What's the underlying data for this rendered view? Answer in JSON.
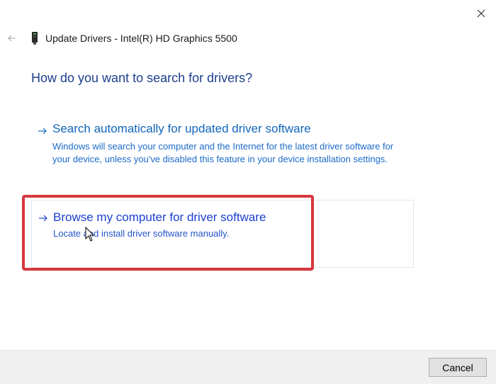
{
  "window": {
    "title": "Update Drivers - Intel(R) HD Graphics 5500",
    "close_icon": "close-icon",
    "back_icon": "back-arrow-icon",
    "device_icon": "graphics-card-icon"
  },
  "main": {
    "question": "How do you want to search for drivers?",
    "options": [
      {
        "title": "Search automatically for updated driver software",
        "description": "Windows will search your computer and the Internet for the latest driver software for your device, unless you've disabled this feature in your device installation settings."
      },
      {
        "title": "Browse my computer for driver software",
        "description": "Locate and install driver software manually."
      }
    ]
  },
  "footer": {
    "cancel_label": "Cancel"
  },
  "colors": {
    "question": "#1d3f8c",
    "option_link": "#1166bb",
    "highlight": "#d7373f",
    "footer_bg": "#f0f0f0"
  }
}
